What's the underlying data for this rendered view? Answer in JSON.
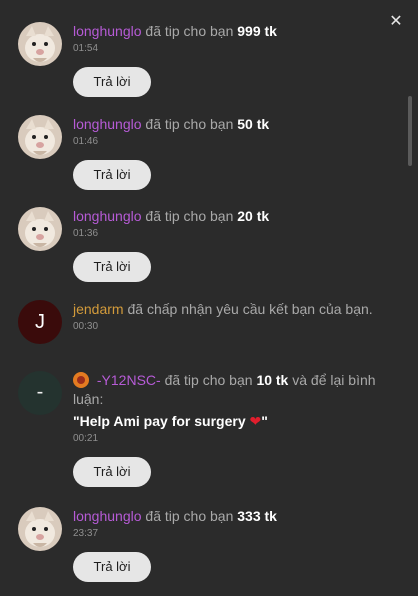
{
  "items": [
    {
      "user": "longhunglo",
      "action": "đã tip cho bạn",
      "amount": "999 tk",
      "time": "01:54",
      "reply": "Trả lời"
    },
    {
      "user": "longhunglo",
      "action": "đã tip cho bạn",
      "amount": "50 tk",
      "time": "01:46",
      "reply": "Trả lời"
    },
    {
      "user": "longhunglo",
      "action": "đã tip cho bạn",
      "amount": "20 tk",
      "time": "01:36",
      "reply": "Trả lời"
    },
    {
      "user": "jendarm",
      "avatar": "J",
      "action": "đã chấp nhận yêu cầu kết bạn của bạn.",
      "time": "00:30"
    },
    {
      "user": "-Y12NSC-",
      "avatar": "-",
      "action": "đã tip cho bạn",
      "amount": "10 tk",
      "action2": "và để lại bình luận:",
      "quote_open": "\"Help Ami pay for surgery",
      "quote_close": "\"",
      "time": "00:21",
      "reply": "Trả lời"
    },
    {
      "user": "longhunglo",
      "action": "đã tip cho bạn",
      "amount": "333 tk",
      "time": "23:37",
      "reply": "Trả lời"
    }
  ],
  "icons": {
    "close": "close-icon",
    "heart": "heart-icon",
    "badge": "rank-badge-icon"
  }
}
